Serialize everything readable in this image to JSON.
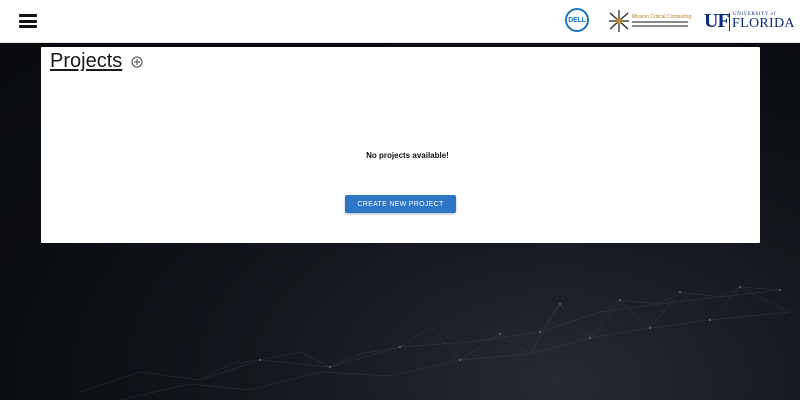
{
  "header": {
    "menu_icon": "hamburger-menu-icon",
    "logos": {
      "dell": "DELL",
      "mcc_title": "Mission Critical Computing",
      "uf_mark": "UF",
      "uf_small": "UNIVERSITY of",
      "uf_big": "FLORIDA"
    }
  },
  "projects": {
    "title": "Projects",
    "add_icon": "circle-plus-icon",
    "empty_message": "No projects available!",
    "create_button_label": "CREATE NEW PROJECT"
  },
  "colors": {
    "accent": "#2d76c7",
    "background": "#0b0e14",
    "card": "#ffffff"
  }
}
